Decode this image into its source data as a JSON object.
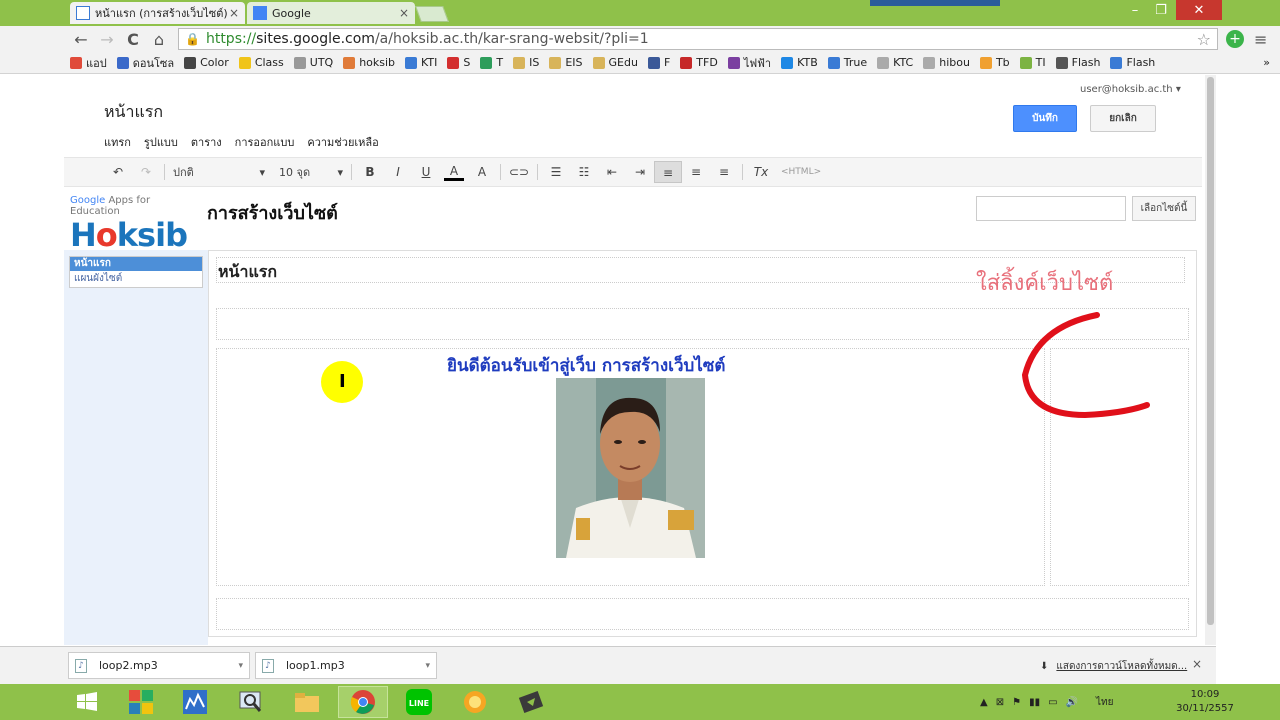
{
  "browser": {
    "tabs": [
      {
        "label": "หน้าแรก (การสร้างเว็บไซต์)",
        "close": "×"
      },
      {
        "label": "Google",
        "close": "×"
      }
    ],
    "window_controls": {
      "minimize": "–",
      "restore": "❐",
      "close": "✕"
    },
    "nav": {
      "back": "←",
      "forward": "→",
      "reload": "C",
      "home": "⌂"
    },
    "url": {
      "scheme": "https://",
      "host": "sites.google.com",
      "path": "/a/hoksib.ac.th/kar-srang-websit/?pli=1"
    },
    "star": "☆",
    "menu": "≡",
    "bookmarks": [
      {
        "label": "แอป",
        "color": "#e04b3a"
      },
      {
        "label": "ดอนโซล",
        "color": "#3a69c9"
      },
      {
        "label": "Color",
        "color": "#444444"
      },
      {
        "label": "Class",
        "color": "#f0c419"
      },
      {
        "label": "UTQ",
        "color": "#999999"
      },
      {
        "label": "hoksib",
        "color": "#e07b39"
      },
      {
        "label": "KTI",
        "color": "#3a7bd5"
      },
      {
        "label": "S",
        "color": "#d32f2f"
      },
      {
        "label": "T",
        "color": "#2e9d5b"
      },
      {
        "label": "IS",
        "color": "#d8b45a"
      },
      {
        "label": "EIS",
        "color": "#d8b45a"
      },
      {
        "label": "GEdu",
        "color": "#d8b45a"
      },
      {
        "label": "F",
        "color": "#3b5998"
      },
      {
        "label": "TFD",
        "color": "#c62828"
      },
      {
        "label": "ไฟฟ้า",
        "color": "#7b3fa0"
      },
      {
        "label": "KTB",
        "color": "#1e88e5"
      },
      {
        "label": "True",
        "color": "#3a7bd5"
      },
      {
        "label": "KTC",
        "color": "#aaaaaa"
      },
      {
        "label": "hibou",
        "color": "#aaaaaa"
      },
      {
        "label": "Tb",
        "color": "#f0a030"
      },
      {
        "label": "TI",
        "color": "#7cb342"
      },
      {
        "label": "Flash",
        "color": "#555555"
      },
      {
        "label": "Flash",
        "color": "#3a7bd5"
      }
    ],
    "more": "»"
  },
  "editor": {
    "user": "user@hoksib.ac.th ▾",
    "page_title": "หน้าแรก",
    "menu": [
      "แทรก",
      "รูปแบบ",
      "ตาราง",
      "การออกแบบ",
      "ความช่วยเหลือ"
    ],
    "save_label": "บันทึก",
    "cancel_label": "ยกเลิก",
    "format": {
      "undo": "↶",
      "redo": "↷",
      "style": "ปกติ",
      "size": "10 จุด",
      "bold": "B",
      "italic": "I",
      "underline": "U",
      "text_color": "A",
      "bg_color": "A",
      "link": "⊂⊃",
      "numbered": "☰",
      "bulleted": "☷",
      "outdent": "⇤",
      "indent": "⇥",
      "align_left": "≡",
      "align_center": "≡",
      "align_right": "≡",
      "clear": "Tx",
      "html": "<HTML>"
    }
  },
  "site": {
    "logo_tagline": {
      "google": "Google",
      "rest": " Apps for Education"
    },
    "logo_brand": {
      "h": "H",
      "o": "o",
      "rest": "ksib"
    },
    "title": "การสร้างเว็บไซต์",
    "search_button": "เลือกไซต์นี้",
    "nav": [
      {
        "label": "หน้าแรก",
        "selected": true
      },
      {
        "label": "แผนผังไซต์",
        "selected": false
      }
    ],
    "page_heading": "หน้าแรก",
    "welcome": "ยินดีต้อนรับเข้าสู่เว็บ การสร้างเว็บไซต์",
    "annotation": "ใส่ลิ้งค์เว็บไซต์"
  },
  "downloads": {
    "files": [
      "loop2.mp3",
      "loop1.mp3"
    ],
    "show_all": "แสดงการดาวน์โหลดทั้งหมด...",
    "close": "×"
  },
  "taskbar": {
    "tray_lang": "ไทย",
    "time": "10:09",
    "date": "30/11/2557"
  }
}
